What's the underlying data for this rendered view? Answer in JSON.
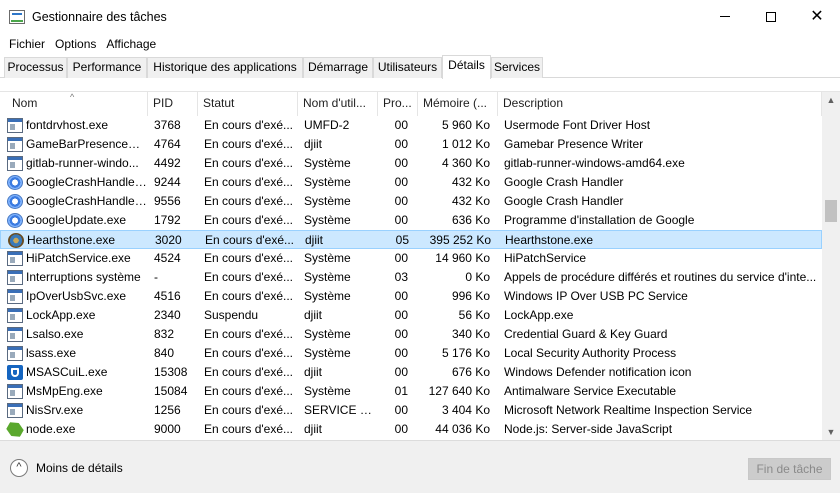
{
  "window": {
    "title": "Gestionnaire des tâches",
    "minimize_glyph": "",
    "close_glyph": "✕"
  },
  "menu": [
    "Fichier",
    "Options",
    "Affichage"
  ],
  "tabs": [
    {
      "label": "Processus",
      "active": false
    },
    {
      "label": "Performance",
      "active": false
    },
    {
      "label": "Historique des applications",
      "active": false
    },
    {
      "label": "Démarrage",
      "active": false
    },
    {
      "label": "Utilisateurs",
      "active": false
    },
    {
      "label": "Détails",
      "active": true
    },
    {
      "label": "Services",
      "active": false
    }
  ],
  "columns": {
    "name": "Nom",
    "pid": "PID",
    "status": "Statut",
    "user": "Nom d'util...",
    "cpu": "Pro...",
    "memory": "Mémoire (...",
    "description": "Description",
    "sort_indicator": "^"
  },
  "processes": [
    {
      "icon": "window-icon",
      "name": "fontdrvhost.exe",
      "pid": "3768",
      "status": "En cours d'exé...",
      "user": "UMFD-2",
      "cpu": "00",
      "memory": "5 960 Ko",
      "description": "Usermode Font Driver Host"
    },
    {
      "icon": "window-icon",
      "name": "GameBarPresenceWr...",
      "pid": "4764",
      "status": "En cours d'exé...",
      "user": "djiit",
      "cpu": "00",
      "memory": "1 012 Ko",
      "description": "Gamebar Presence Writer"
    },
    {
      "icon": "window-icon",
      "name": "gitlab-runner-windo...",
      "pid": "4492",
      "status": "En cours d'exé...",
      "user": "Système",
      "cpu": "00",
      "memory": "4 360 Ko",
      "description": "gitlab-runner-windows-amd64.exe"
    },
    {
      "icon": "google-icon",
      "name": "GoogleCrashHandler....",
      "pid": "9244",
      "status": "En cours d'exé...",
      "user": "Système",
      "cpu": "00",
      "memory": "432 Ko",
      "description": "Google Crash Handler"
    },
    {
      "icon": "google-icon",
      "name": "GoogleCrashHandler....",
      "pid": "9556",
      "status": "En cours d'exé...",
      "user": "Système",
      "cpu": "00",
      "memory": "432 Ko",
      "description": "Google Crash Handler"
    },
    {
      "icon": "google-icon",
      "name": "GoogleUpdate.exe",
      "pid": "1792",
      "status": "En cours d'exé...",
      "user": "Système",
      "cpu": "00",
      "memory": "636 Ko",
      "description": "Programme d'installation de Google"
    },
    {
      "icon": "hearthstone-icon",
      "name": "Hearthstone.exe",
      "pid": "3020",
      "status": "En cours d'exé...",
      "user": "djiit",
      "cpu": "05",
      "memory": "395 252 Ko",
      "description": "Hearthstone.exe",
      "selected": true
    },
    {
      "icon": "window-icon",
      "name": "HiPatchService.exe",
      "pid": "4524",
      "status": "En cours d'exé...",
      "user": "Système",
      "cpu": "00",
      "memory": "14 960 Ko",
      "description": "HiPatchService"
    },
    {
      "icon": "window-icon",
      "name": "Interruptions système",
      "pid": "-",
      "status": "En cours d'exé...",
      "user": "Système",
      "cpu": "03",
      "memory": "0 Ko",
      "description": "Appels de procédure différés et routines du service d'inte..."
    },
    {
      "icon": "window-icon",
      "name": "IpOverUsbSvc.exe",
      "pid": "4516",
      "status": "En cours d'exé...",
      "user": "Système",
      "cpu": "00",
      "memory": "996 Ko",
      "description": "Windows IP Over USB PC Service"
    },
    {
      "icon": "window-icon",
      "name": "LockApp.exe",
      "pid": "2340",
      "status": "Suspendu",
      "user": "djiit",
      "cpu": "00",
      "memory": "56 Ko",
      "description": "LockApp.exe"
    },
    {
      "icon": "window-icon",
      "name": "Lsalso.exe",
      "pid": "832",
      "status": "En cours d'exé...",
      "user": "Système",
      "cpu": "00",
      "memory": "340 Ko",
      "description": "Credential Guard & Key Guard"
    },
    {
      "icon": "window-icon",
      "name": "lsass.exe",
      "pid": "840",
      "status": "En cours d'exé...",
      "user": "Système",
      "cpu": "00",
      "memory": "5 176 Ko",
      "description": "Local Security Authority Process"
    },
    {
      "icon": "shield-icon",
      "name": "MSASCuiL.exe",
      "pid": "15308",
      "status": "En cours d'exé...",
      "user": "djiit",
      "cpu": "00",
      "memory": "676 Ko",
      "description": "Windows Defender notification icon"
    },
    {
      "icon": "window-icon",
      "name": "MsMpEng.exe",
      "pid": "15084",
      "status": "En cours d'exé...",
      "user": "Système",
      "cpu": "01",
      "memory": "127 640 Ko",
      "description": "Antimalware Service Executable"
    },
    {
      "icon": "window-icon",
      "name": "NisSrv.exe",
      "pid": "1256",
      "status": "En cours d'exé...",
      "user": "SERVICE R...",
      "cpu": "00",
      "memory": "3 404 Ko",
      "description": "Microsoft Network Realtime Inspection Service"
    },
    {
      "icon": "node-icon",
      "name": "node.exe",
      "pid": "9000",
      "status": "En cours d'exé...",
      "user": "djiit",
      "cpu": "00",
      "memory": "44 036 Ko",
      "description": "Node.js: Server-side JavaScript"
    }
  ],
  "footer": {
    "less_details_label": "Moins de détails",
    "less_details_icon": "^",
    "end_task_label": "Fin de tâche",
    "end_task_enabled": false
  },
  "scrollbar": {
    "up_glyph": "▲",
    "down_glyph": "▼"
  }
}
